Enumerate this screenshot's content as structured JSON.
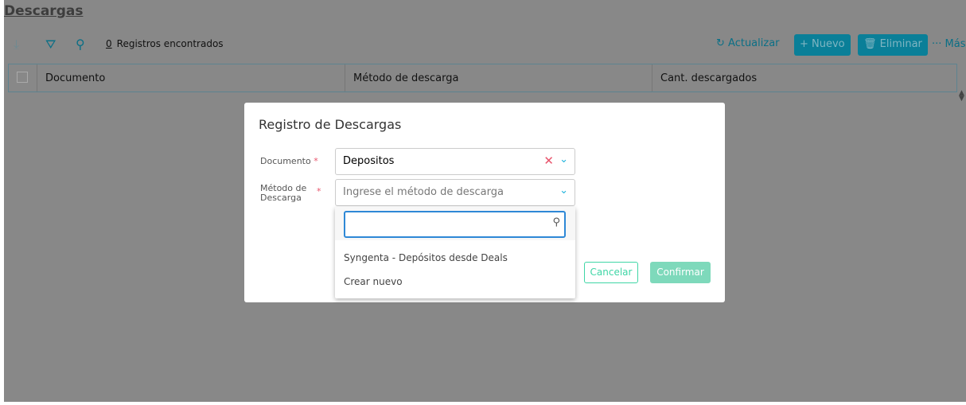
{
  "page": {
    "title": "Descargas",
    "records_count": "0",
    "records_label": "Registros encontrados"
  },
  "toolbar": {
    "refresh": "Actualizar",
    "new": "Nuevo",
    "delete": "Eliminar",
    "more": "Más"
  },
  "table": {
    "columns": [
      "Documento",
      "Método de descarga",
      "Cant. descargados"
    ]
  },
  "dialog": {
    "title": "Registro de Descargas",
    "documento_label": "Documento",
    "documento_value": "Depositos",
    "metodo_label_1": "Método de",
    "metodo_label_2": "Descarga",
    "metodo_placeholder": "Ingrese el método de descarga",
    "required_mark": "*",
    "options": [
      "Syngenta - Depósitos desde Deals",
      "Crear nuevo"
    ],
    "cancel": "Cancelar",
    "confirm": "Confirmar"
  }
}
